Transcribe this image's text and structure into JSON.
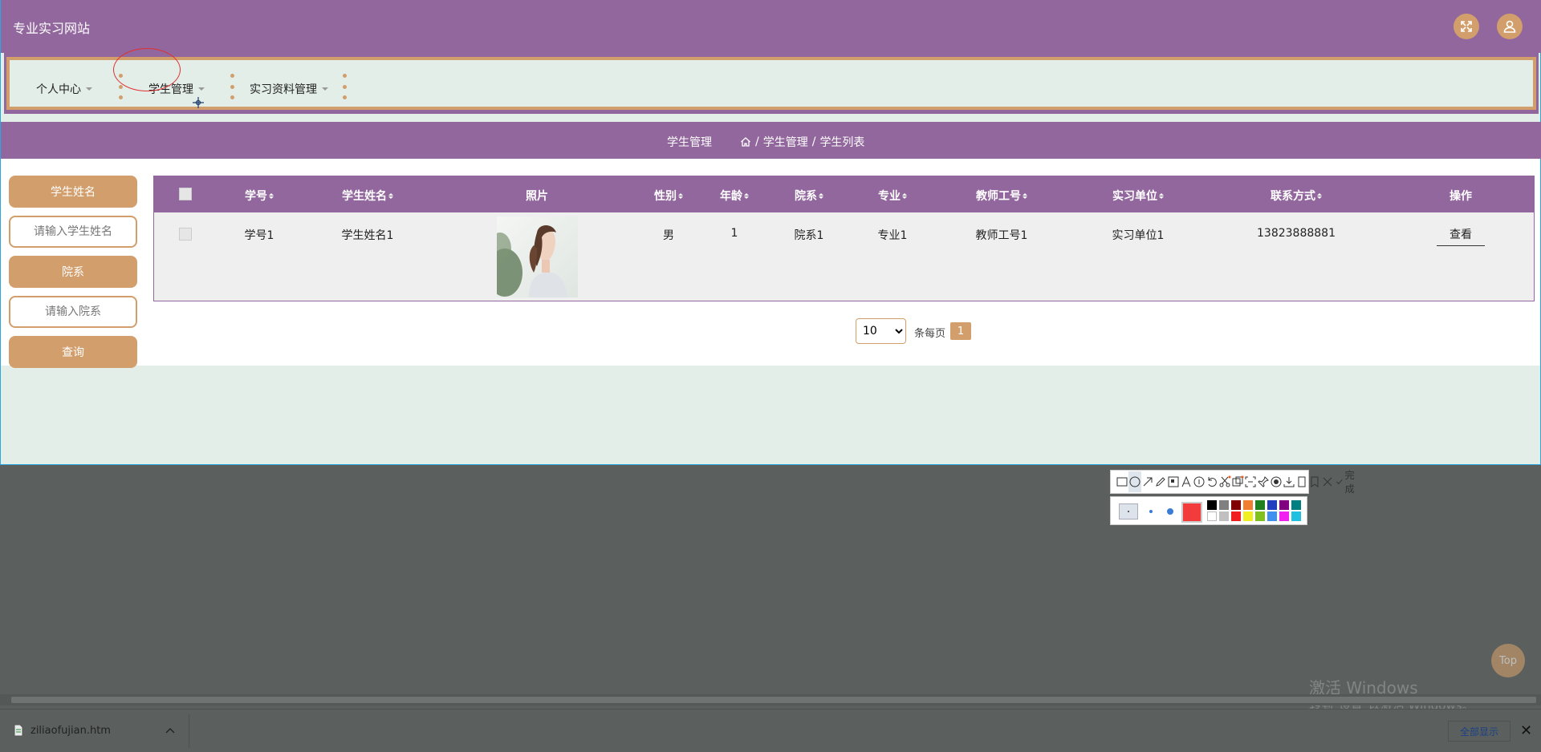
{
  "app": {
    "title": "专业实习网站"
  },
  "nav": {
    "items": [
      {
        "label": "个人中心"
      },
      {
        "label": "学生管理"
      },
      {
        "label": "实习资料管理"
      }
    ]
  },
  "breadcrumb": {
    "title": "学生管理",
    "path": [
      "学生管理",
      "学生列表"
    ],
    "separator": "/"
  },
  "search": {
    "name_label": "学生姓名",
    "name_placeholder": "请输入学生姓名",
    "dept_label": "院系",
    "dept_placeholder": "请输入院系",
    "query_label": "查询"
  },
  "table": {
    "headers": [
      "学号",
      "学生姓名",
      "照片",
      "性别",
      "年龄",
      "院系",
      "专业",
      "教师工号",
      "实习单位",
      "联系方式",
      "操作"
    ],
    "rows": [
      {
        "student_no": "学号1",
        "name": "学生姓名1",
        "gender": "男",
        "age": "1",
        "department": "院系1",
        "major": "专业1",
        "teacher_no": "教师工号1",
        "company": "实习单位1",
        "phone": "13823888881",
        "action": "查看"
      }
    ]
  },
  "pagination": {
    "page_size": "10",
    "per_page_label": "条每页",
    "current_page": "1"
  },
  "snip_tool": {
    "done_label": "完成",
    "current_color": "#f23b3b",
    "palette": [
      "#000000",
      "#808080",
      "#800000",
      "#f08030",
      "#208020",
      "#2040c0",
      "#800080",
      "#008080",
      "#ffffff",
      "#c0c0c0",
      "#f02020",
      "#f0f020",
      "#80c020",
      "#4090f0",
      "#f020f0",
      "#20c0e0"
    ]
  },
  "desktop": {
    "top_button": "Top",
    "watermark_title": "激活 Windows",
    "watermark_sub": "转到\"设置\"以激活 Windows。",
    "download_file": "ziliaofujian.htm",
    "show_all": "全部显示"
  },
  "colors": {
    "primary": "#92679d",
    "accent": "#d29e6b",
    "background": "#e3eee9"
  }
}
